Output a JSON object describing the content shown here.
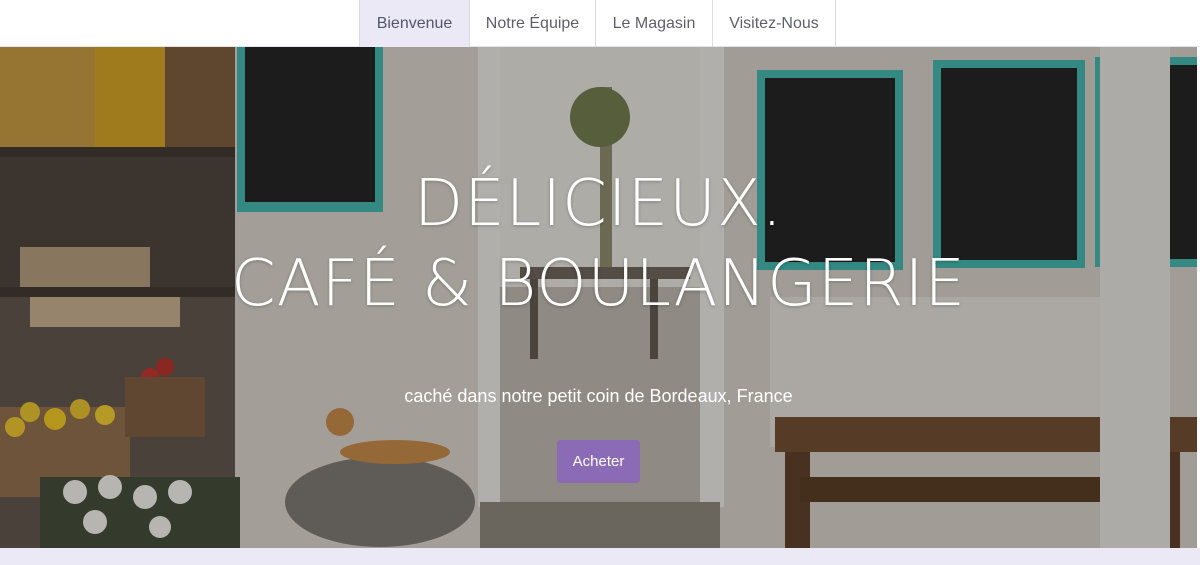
{
  "nav": {
    "tabs": [
      {
        "label": "Bienvenue",
        "active": true
      },
      {
        "label": "Notre Équipe",
        "active": false
      },
      {
        "label": "Le Magasin",
        "active": false
      },
      {
        "label": "Visitez-Nous",
        "active": false
      }
    ]
  },
  "hero": {
    "headline_line1": "DÉLICIEUX.",
    "headline_line2": "CAFÉ & BOULANGERIE",
    "tagline": "caché dans notre petit coin de Bordeaux, France",
    "cta_label": "Acheter"
  },
  "colors": {
    "accent": "#8b6bb6",
    "active_tab_bg": "#ebe9f6",
    "chalkboard_frame": "#3fb6ad"
  }
}
